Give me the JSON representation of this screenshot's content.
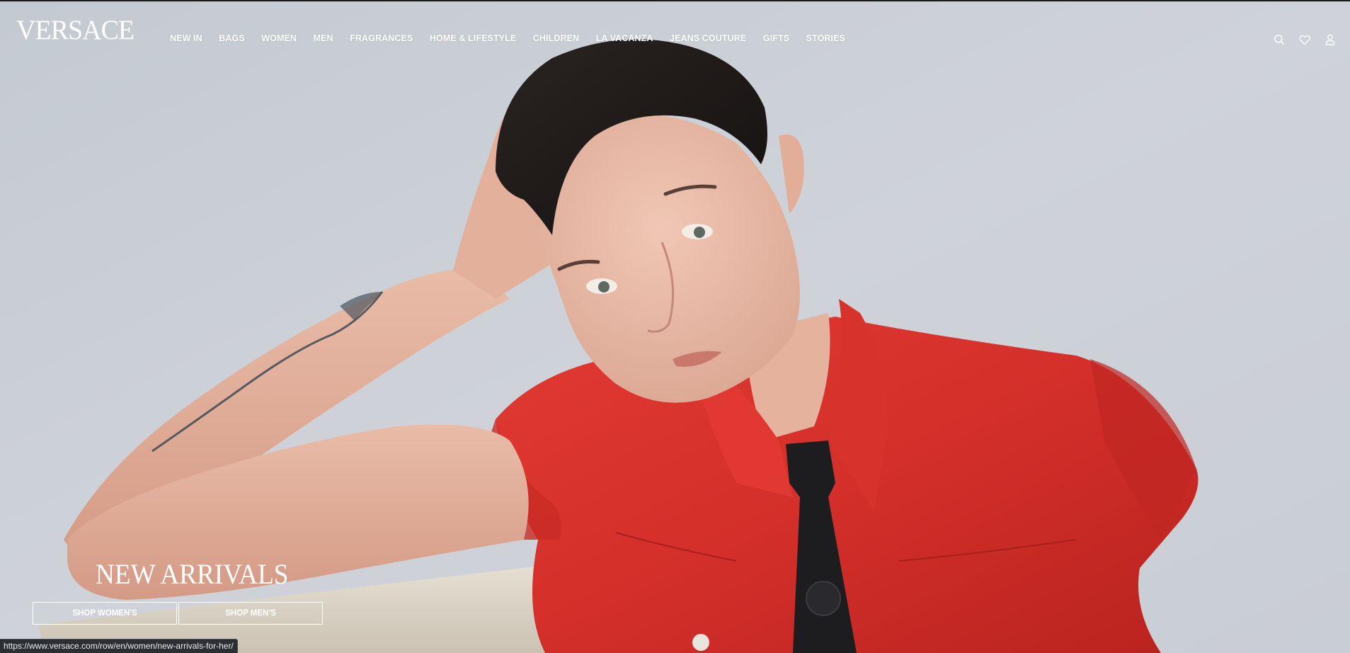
{
  "brand": {
    "logo_text": "VERSACE"
  },
  "nav": {
    "items": [
      {
        "label": "NEW IN"
      },
      {
        "label": "BAGS"
      },
      {
        "label": "WOMEN"
      },
      {
        "label": "MEN"
      },
      {
        "label": "FRAGRANCES"
      },
      {
        "label": "HOME & LIFESTYLE"
      },
      {
        "label": "CHILDREN"
      },
      {
        "label": "LA VACANZA"
      },
      {
        "label": "JEANS COUTURE"
      },
      {
        "label": "GIFTS"
      },
      {
        "label": "STORIES"
      }
    ]
  },
  "utility": {
    "icons": [
      "search-icon",
      "heart-icon",
      "user-icon"
    ]
  },
  "hero": {
    "title": "NEW ARRIVALS",
    "cta_women": "SHOP WOMEN'S",
    "cta_men": "SHOP MEN'S"
  },
  "status_bar": {
    "url": "https://www.versace.com/row/en/women/new-arrivals-for-her/"
  },
  "colors": {
    "background_wall": "#cdd2d8",
    "shirt_red": "#d5302c",
    "tie_black": "#1c1c1e",
    "text_white": "#ffffff",
    "status_bar_bg": "#2b2e33"
  }
}
